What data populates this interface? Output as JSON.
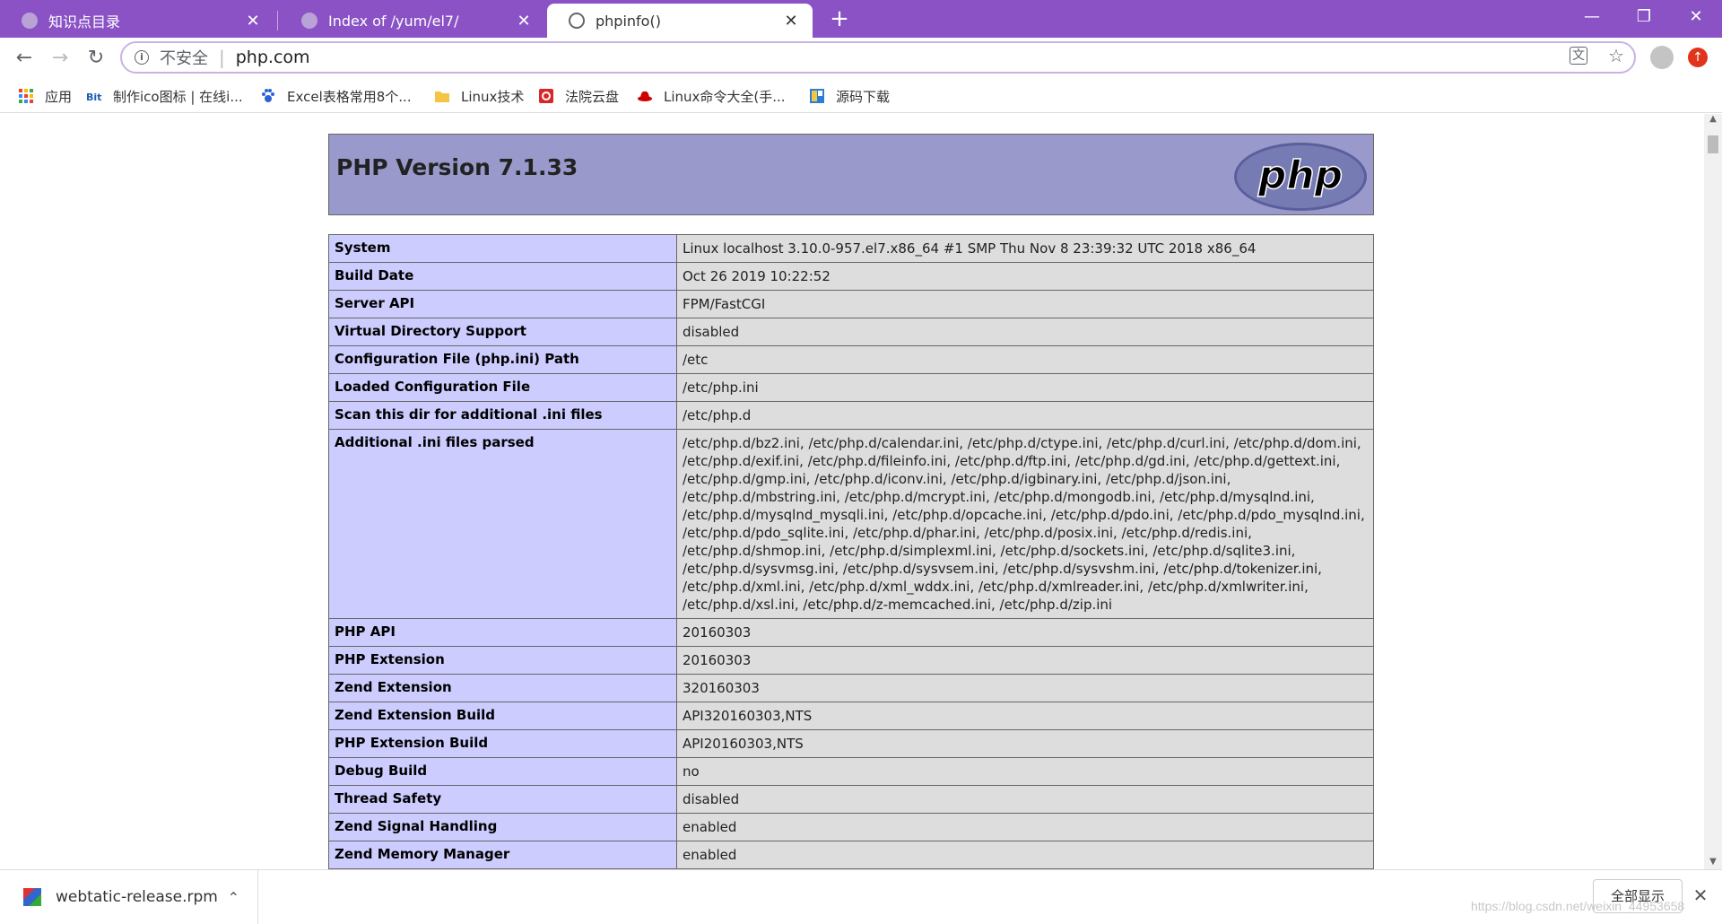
{
  "tabs": [
    {
      "title": "知识点目录",
      "close": "✕"
    },
    {
      "title": "Index of /yum/el7/",
      "close": "✕"
    },
    {
      "title": "phpinfo()",
      "close": "✕"
    }
  ],
  "newtab": "+",
  "window": {
    "minimize": "—",
    "restore": "❐",
    "close": "✕"
  },
  "nav": {
    "back": "←",
    "forward": "→",
    "reload": "↻"
  },
  "omnibox": {
    "info": "i",
    "security_label": "不安全",
    "separator": "|",
    "url": "php.com"
  },
  "omni_icons": {
    "translate": "文",
    "star": "☆"
  },
  "update_icon": "↑",
  "bookmarks": [
    {
      "label": "应用",
      "icon": "apps-icon"
    },
    {
      "label": "制作ico图标 | 在线i...",
      "icon": "bit-icon"
    },
    {
      "label": "Excel表格常用8个...",
      "icon": "paw-icon"
    },
    {
      "label": "Linux技术",
      "icon": "folder-icon"
    },
    {
      "label": "法院云盘",
      "icon": "court-icon"
    },
    {
      "label": "Linux命令大全(手...",
      "icon": "redhat-icon"
    },
    {
      "label": "源码下载",
      "icon": "code-icon"
    }
  ],
  "php": {
    "version_title": "PHP Version 7.1.33",
    "logo_text": "php",
    "rows": [
      {
        "key": "System",
        "value": "Linux localhost 3.10.0-957.el7.x86_64 #1 SMP Thu Nov 8 23:39:32 UTC 2018 x86_64"
      },
      {
        "key": "Build Date",
        "value": "Oct 26 2019 10:22:52"
      },
      {
        "key": "Server API",
        "value": "FPM/FastCGI"
      },
      {
        "key": "Virtual Directory Support",
        "value": "disabled"
      },
      {
        "key": "Configuration File (php.ini) Path",
        "value": "/etc"
      },
      {
        "key": "Loaded Configuration File",
        "value": "/etc/php.ini"
      },
      {
        "key": "Scan this dir for additional .ini files",
        "value": "/etc/php.d"
      },
      {
        "key": "Additional .ini files parsed",
        "value": "/etc/php.d/bz2.ini, /etc/php.d/calendar.ini, /etc/php.d/ctype.ini, /etc/php.d/curl.ini, /etc/php.d/dom.ini, /etc/php.d/exif.ini, /etc/php.d/fileinfo.ini, /etc/php.d/ftp.ini, /etc/php.d/gd.ini, /etc/php.d/gettext.ini, /etc/php.d/gmp.ini, /etc/php.d/iconv.ini, /etc/php.d/igbinary.ini, /etc/php.d/json.ini, /etc/php.d/mbstring.ini, /etc/php.d/mcrypt.ini, /etc/php.d/mongodb.ini, /etc/php.d/mysqlnd.ini, /etc/php.d/mysqlnd_mysqli.ini, /etc/php.d/opcache.ini, /etc/php.d/pdo.ini, /etc/php.d/pdo_mysqlnd.ini, /etc/php.d/pdo_sqlite.ini, /etc/php.d/phar.ini, /etc/php.d/posix.ini, /etc/php.d/redis.ini, /etc/php.d/shmop.ini, /etc/php.d/simplexml.ini, /etc/php.d/sockets.ini, /etc/php.d/sqlite3.ini, /etc/php.d/sysvmsg.ini, /etc/php.d/sysvsem.ini, /etc/php.d/sysvshm.ini, /etc/php.d/tokenizer.ini, /etc/php.d/xml.ini, /etc/php.d/xml_wddx.ini, /etc/php.d/xmlreader.ini, /etc/php.d/xmlwriter.ini, /etc/php.d/xsl.ini, /etc/php.d/z-memcached.ini, /etc/php.d/zip.ini"
      },
      {
        "key": "PHP API",
        "value": "20160303"
      },
      {
        "key": "PHP Extension",
        "value": "20160303"
      },
      {
        "key": "Zend Extension",
        "value": "320160303"
      },
      {
        "key": "Zend Extension Build",
        "value": "API320160303,NTS"
      },
      {
        "key": "PHP Extension Build",
        "value": "API20160303,NTS"
      },
      {
        "key": "Debug Build",
        "value": "no"
      },
      {
        "key": "Thread Safety",
        "value": "disabled"
      },
      {
        "key": "Zend Signal Handling",
        "value": "enabled"
      },
      {
        "key": "Zend Memory Manager",
        "value": "enabled"
      }
    ]
  },
  "scroll_arrows": {
    "up": "▲",
    "down": "▼"
  },
  "download": {
    "filename": "webtatic-release.rpm",
    "chevron": "⌃",
    "show_all": "全部显示",
    "close": "✕"
  },
  "watermark": "https://blog.csdn.net/weixin_44953658",
  "colors": {
    "tab_strip": "#8a52c5",
    "php_header": "#9999cc",
    "key_cell": "#ccccff",
    "value_cell": "#dddddd"
  }
}
